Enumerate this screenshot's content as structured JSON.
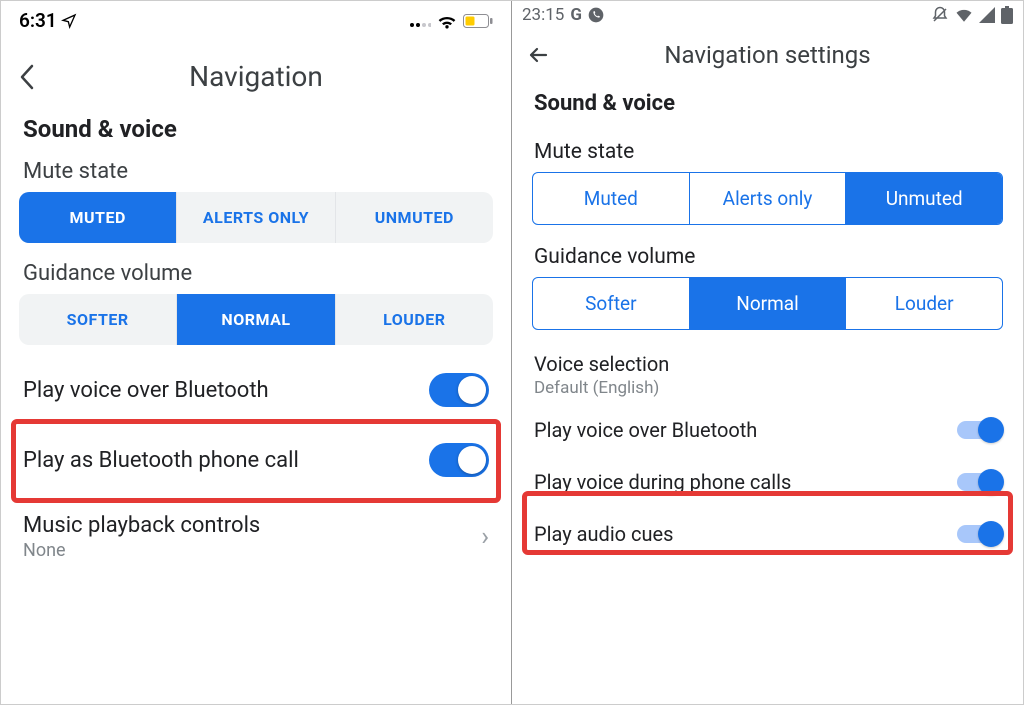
{
  "ios": {
    "status_time": "6:31",
    "header_title": "Navigation",
    "section": "Sound & voice",
    "mute_state": {
      "label": "Mute state",
      "options": [
        "MUTED",
        "ALERTS ONLY",
        "UNMUTED"
      ],
      "selected_index": 0
    },
    "guidance": {
      "label": "Guidance volume",
      "options": [
        "SOFTER",
        "NORMAL",
        "LOUDER"
      ],
      "selected_index": 1
    },
    "play_bluetooth": {
      "label": "Play voice over Bluetooth",
      "on": true
    },
    "play_phone_call": {
      "label": "Play as Bluetooth phone call",
      "on": true
    },
    "music_controls": {
      "label": "Music playback controls",
      "value": "None"
    }
  },
  "android": {
    "status_time": "23:15",
    "header_title": "Navigation settings",
    "section": "Sound & voice",
    "mute_state": {
      "label": "Mute state",
      "options": [
        "Muted",
        "Alerts only",
        "Unmuted"
      ],
      "selected_index": 2
    },
    "guidance": {
      "label": "Guidance volume",
      "options": [
        "Softer",
        "Normal",
        "Louder"
      ],
      "selected_index": 1
    },
    "voice_selection": {
      "label": "Voice selection",
      "value": "Default (English)"
    },
    "play_bluetooth": {
      "label": "Play voice over Bluetooth",
      "on": true
    },
    "play_during_call": {
      "label": "Play voice during phone calls",
      "on": true
    },
    "play_audio_cues": {
      "label": "Play audio cues",
      "on": true
    }
  }
}
